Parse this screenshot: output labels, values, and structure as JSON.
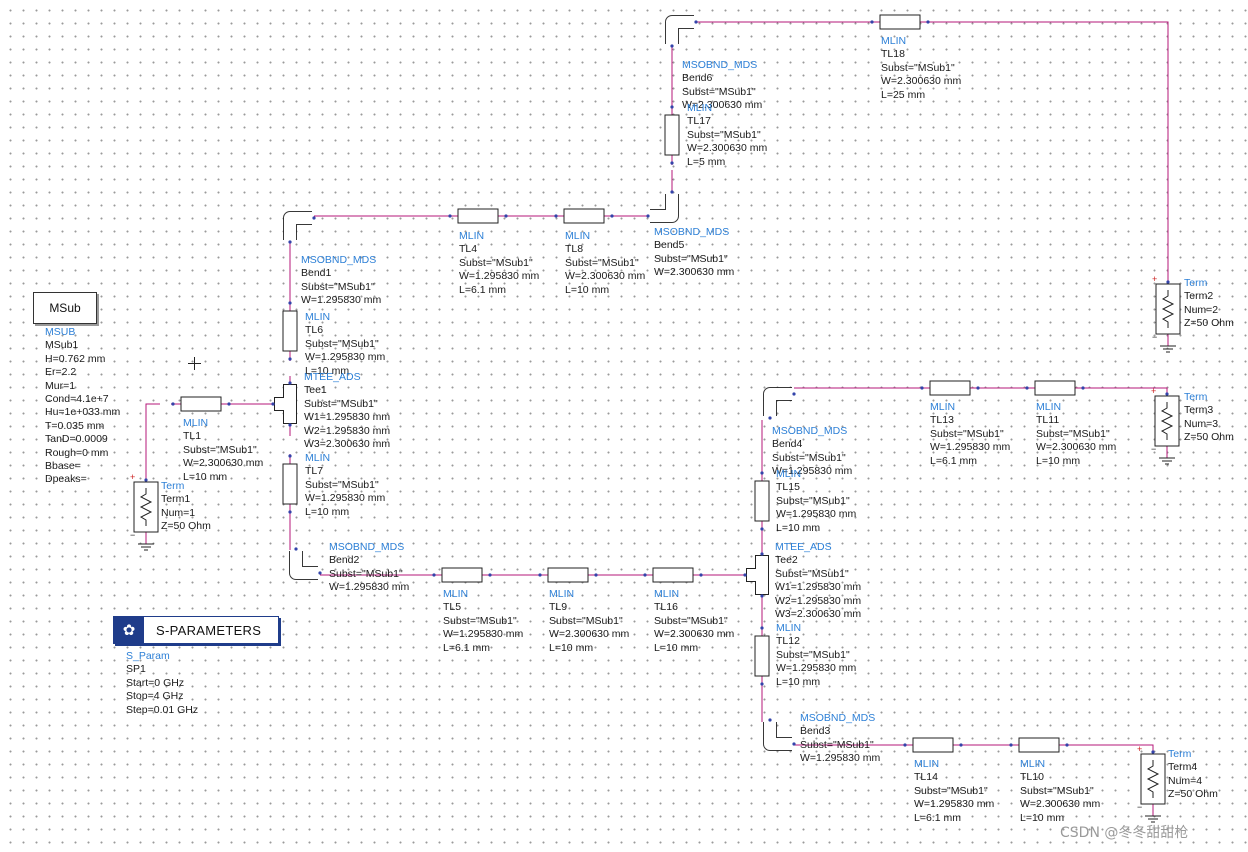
{
  "msub_box": {
    "label": "MSub"
  },
  "sparam_box": {
    "title": "S-PARAMETERS",
    "icon": "sparam-icon"
  },
  "labels": {
    "msub": [
      "MSUB",
      "MSub1",
      "H=0.762 mm",
      "Er=2.2",
      "Mur=1",
      "Cond=4.1e+7",
      "Hu=1e+033 mm",
      "T=0.035 mm",
      "TanD=0.0009",
      "Rough=0 mm",
      "Bbase=",
      "Dpeaks="
    ],
    "tl1": [
      "MLIN",
      "TL1",
      "Subst=\"MSub1\"",
      "W=2.300630 mm",
      "L=10 mm"
    ],
    "term1": [
      "Term",
      "Term1",
      "Num=1",
      "Z=50 Ohm"
    ],
    "sp1": [
      "S_Param",
      "SP1",
      "Start=0 GHz",
      "Stop=4 GHz",
      "Step=0.01 GHz"
    ],
    "bend1": [
      "MSOBND_MDS",
      "Bend1",
      "Subst=\"MSub1\"",
      "W=1.295830 mm"
    ],
    "tl6": [
      "MLIN",
      "TL6",
      "Subst=\"MSub1\"",
      "W=1.295830 mm",
      "L=10 mm"
    ],
    "tee1": [
      "MTEE_ADS",
      "Tee1",
      "Subst=\"MSub1\"",
      "W1=1.295830 mm",
      "W2=1.295830 mm",
      "W3=2.300630 mm"
    ],
    "tl7": [
      "MLIN",
      "TL7",
      "Subst=\"MSub1\"",
      "W=1.295830 mm",
      "L=10 mm"
    ],
    "bend2": [
      "MSOBND_MDS",
      "Bend2",
      "Subst=\"MSub1\"",
      "W=1.295830 mm"
    ],
    "tl5": [
      "MLIN",
      "TL5",
      "Subst=\"MSub1\"",
      "W=1.295830 mm",
      "L=6.1 mm"
    ],
    "tl9": [
      "MLIN",
      "TL9",
      "Subst=\"MSub1\"",
      "W=2.300630 mm",
      "L=10 mm"
    ],
    "tl16": [
      "MLIN",
      "TL16",
      "Subst=\"MSub1\"",
      "W=2.300630 mm",
      "L=10 mm"
    ],
    "tl4": [
      "MLIN",
      "TL4",
      "Subst=\"MSub1\"",
      "W=1.295830 mm",
      "L=6.1 mm"
    ],
    "tl8": [
      "MLIN",
      "TL8",
      "Subst=\"MSub1\"",
      "W=2.300630 mm",
      "L=10 mm"
    ],
    "bend5": [
      "MSOBND_MDS",
      "Bend5",
      "Subst=\"MSub1\"",
      "W=2.300630 mm"
    ],
    "bend6": [
      "MSOBND_MDS",
      "Bend6",
      "Subst=\"MSub1\"",
      "W=2.300630 mm"
    ],
    "tl17": [
      "MLIN",
      "TL17",
      "Subst=\"MSub1\"",
      "W=2.300630 mm",
      "L=5 mm"
    ],
    "tl18": [
      "MLIN",
      "TL18",
      "Subst=\"MSub1\"",
      "W=2.300630 mm",
      "L=25 mm"
    ],
    "term2": [
      "Term",
      "Term2",
      "Num=2",
      "Z=50 Ohm"
    ],
    "bend4": [
      "MSOBND_MDS",
      "Bend4",
      "Subst=\"MSub1\"",
      "W=1.295830 mm"
    ],
    "tl13": [
      "MLIN",
      "TL13",
      "Subst=\"MSub1\"",
      "W=1.295830 mm",
      "L=6.1 mm"
    ],
    "tl11": [
      "MLIN",
      "TL11",
      "Subst=\"MSub1\"",
      "W=2.300630 mm",
      "L=10 mm"
    ],
    "term3": [
      "Term",
      "Term3",
      "Num=3",
      "Z=50 Ohm"
    ],
    "tl15": [
      "MLIN",
      "TL15",
      "Subst=\"MSub1\"",
      "W=1.295830 mm",
      "L=10 mm"
    ],
    "tee2": [
      "MTEE_ADS",
      "Tee2",
      "Subst=\"MSub1\"",
      "W1=1.295830 mm",
      "W2=1.295830 mm",
      "W3=2.300630 mm"
    ],
    "tl12": [
      "MLIN",
      "TL12",
      "Subst=\"MSub1\"",
      "W=1.295830 mm",
      "L=10 mm"
    ],
    "bend3": [
      "MSOBND_MDS",
      "Bend3",
      "Subst=\"MSub1\"",
      "W=1.295830 mm"
    ],
    "tl14": [
      "MLIN",
      "TL14",
      "Subst=\"MSub1\"",
      "W=1.295830 mm",
      "L=6.1 mm"
    ],
    "tl10": [
      "MLIN",
      "TL10",
      "Subst=\"MSub1\"",
      "W=2.300630 mm",
      "L=10 mm"
    ],
    "term4": [
      "Term",
      "Term4",
      "Num=4",
      "Z=50 Ohm"
    ]
  },
  "watermark": "CSDN @冬冬甜甜枪",
  "colors": {
    "wire": "#b5177a",
    "label_type": "#2c7fd6",
    "component_stroke": "#222222",
    "sparam_brand": "#1f3c8a"
  }
}
